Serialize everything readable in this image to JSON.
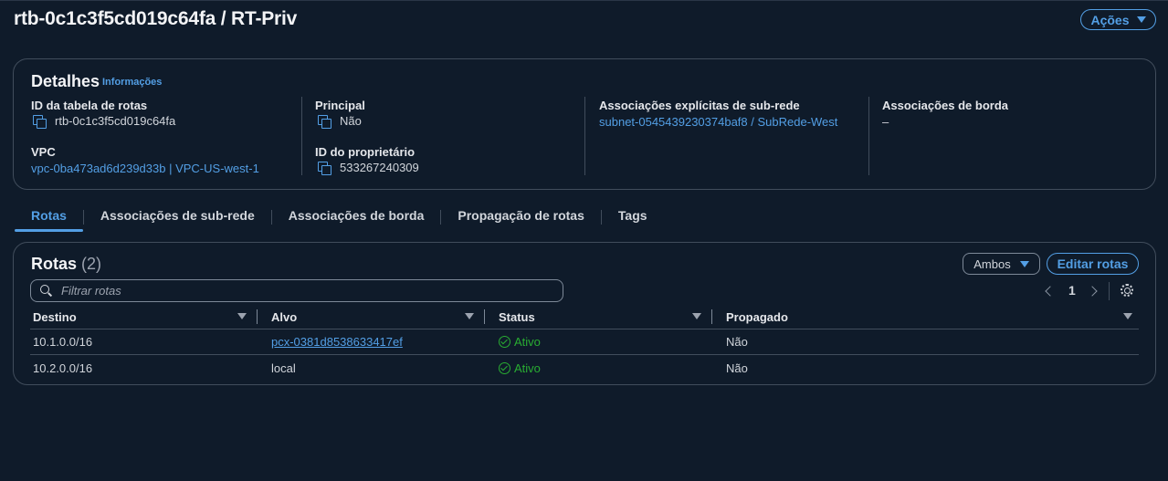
{
  "page": {
    "title": "rtb-0c1c3f5cd019c64fa / RT-Priv",
    "actions_label": "Ações"
  },
  "details": {
    "heading": "Detalhes",
    "info_link": "Informações",
    "route_table_id_label": "ID da tabela de rotas",
    "route_table_id_value": "rtb-0c1c3f5cd019c64fa",
    "vpc_label": "VPC",
    "vpc_value": "vpc-0ba473ad6d239d33b | VPC-US-west-1",
    "main_label": "Principal",
    "main_value": "Não",
    "owner_label": "ID do proprietário",
    "owner_value": "533267240309",
    "explicit_assoc_label": "Associações explícitas de sub-rede",
    "explicit_assoc_value": "subnet-0545439230374baf8 / SubRede-West",
    "edge_assoc_label": "Associações de borda",
    "edge_assoc_value": "–"
  },
  "tabs": [
    {
      "label": "Rotas",
      "active": true
    },
    {
      "label": "Associações de sub-rede",
      "active": false
    },
    {
      "label": "Associações de borda",
      "active": false
    },
    {
      "label": "Propagação de rotas",
      "active": false
    },
    {
      "label": "Tags",
      "active": false
    }
  ],
  "routes": {
    "heading": "Rotas",
    "count": "(2)",
    "filter_select": "Ambos",
    "edit_button": "Editar rotas",
    "search_placeholder": "Filtrar rotas",
    "page_number": "1",
    "columns": [
      "Destino",
      "Alvo",
      "Status",
      "Propagado"
    ],
    "rows": [
      {
        "destination": "10.1.0.0/16",
        "target": "pcx-0381d8538633417ef",
        "target_is_link": true,
        "status": "Ativo",
        "propagated": "Não"
      },
      {
        "destination": "10.2.0.0/16",
        "target": "local",
        "target_is_link": false,
        "status": "Ativo",
        "propagated": "Não"
      }
    ]
  },
  "colors": {
    "background": "#0f1b2a",
    "accent": "#539fe5",
    "success": "#29ad32",
    "border": "#414d5c"
  }
}
